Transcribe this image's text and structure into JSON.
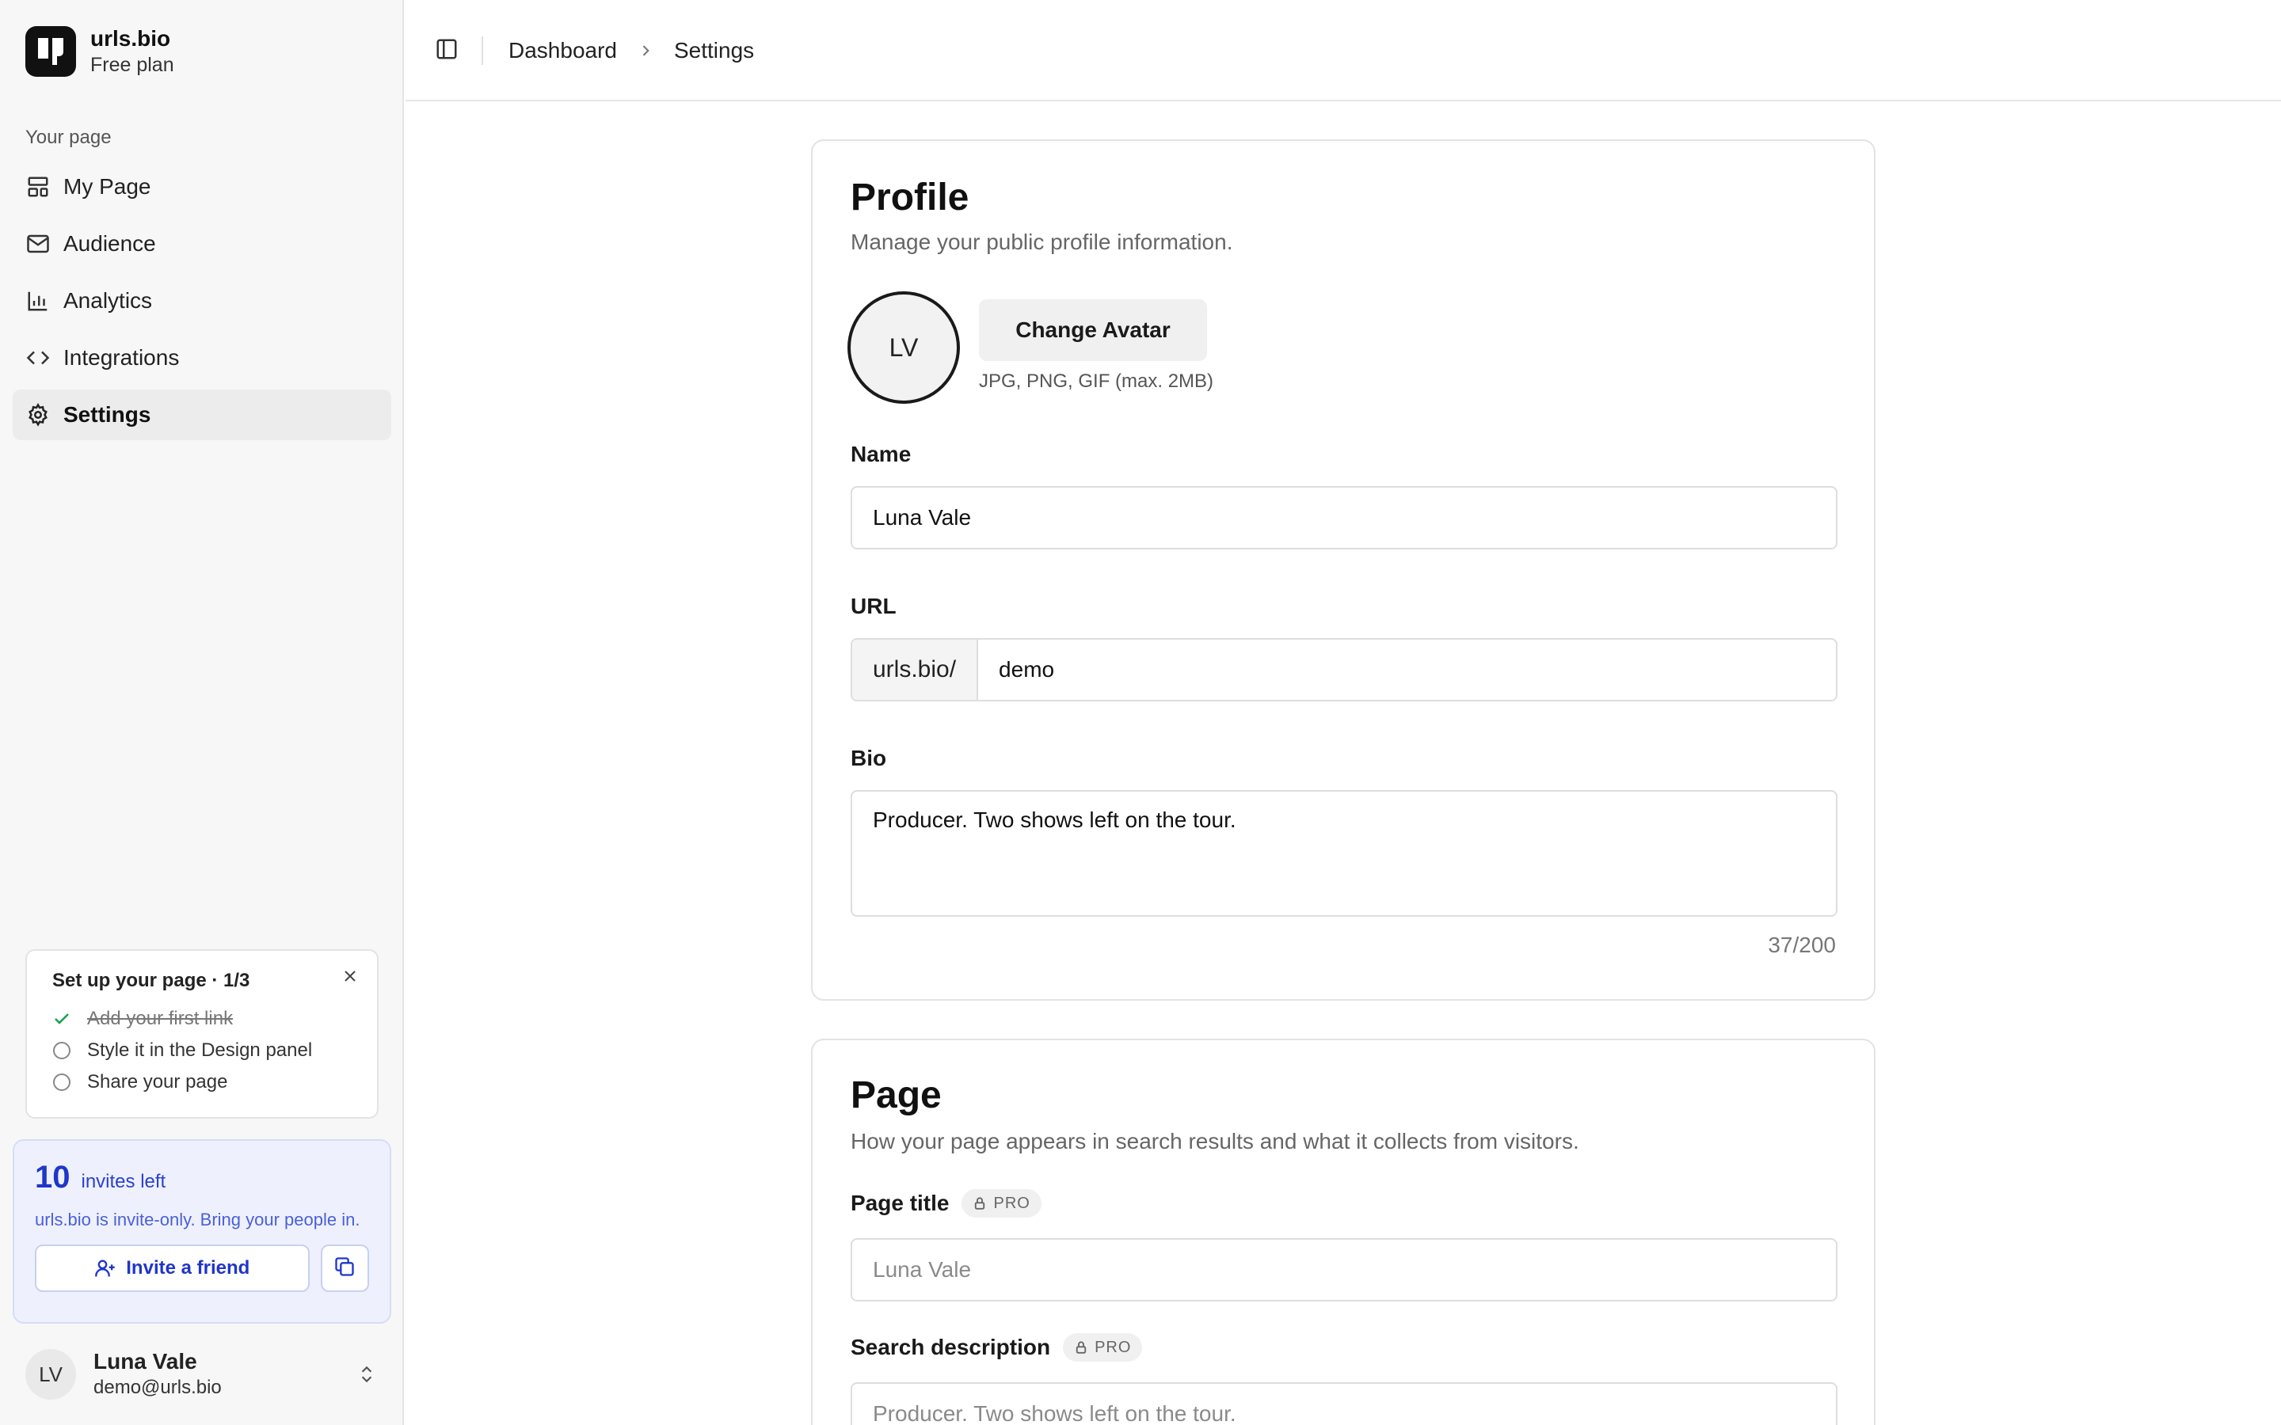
{
  "brand": {
    "name": "urls.bio",
    "plan": "Free plan"
  },
  "sidebar": {
    "section_label": "Your page",
    "items": [
      {
        "label": "My Page",
        "icon": "layout-icon"
      },
      {
        "label": "Audience",
        "icon": "mail-icon"
      },
      {
        "label": "Analytics",
        "icon": "bar-chart-icon"
      },
      {
        "label": "Integrations",
        "icon": "code-icon"
      },
      {
        "label": "Settings",
        "icon": "gear-icon",
        "active": true
      }
    ]
  },
  "setup": {
    "title": "Set up your page · 1/3",
    "steps": [
      {
        "label": "Add your first link",
        "done": true
      },
      {
        "label": "Style it in the Design panel",
        "done": false
      },
      {
        "label": "Share your page",
        "done": false
      }
    ]
  },
  "invites": {
    "count": "10",
    "left_label": "invites left",
    "description": "urls.bio is invite-only. Bring your people in.",
    "button_label": "Invite a friend"
  },
  "user": {
    "initials": "LV",
    "name": "Luna Vale",
    "email": "demo@urls.bio"
  },
  "breadcrumb": {
    "parent": "Dashboard",
    "current": "Settings"
  },
  "profile": {
    "title": "Profile",
    "subtitle": "Manage your public profile information.",
    "avatar_initials": "LV",
    "change_avatar_label": "Change Avatar",
    "avatar_hint": "JPG, PNG, GIF (max. 2MB)",
    "name_label": "Name",
    "name_value": "Luna Vale",
    "url_label": "URL",
    "url_prefix": "urls.bio/",
    "url_value": "demo",
    "bio_label": "Bio",
    "bio_value": "Producer. Two shows left on the tour.",
    "bio_counter": "37/200"
  },
  "page": {
    "title": "Page",
    "subtitle": "How your page appears in search results and what it collects from visitors.",
    "page_title_label": "Page title",
    "page_title_placeholder": "Luna Vale",
    "search_desc_label": "Search description",
    "search_desc_placeholder": "Producer. Two shows left on the tour.",
    "pro_badge": "PRO"
  },
  "colors": {
    "accent": "#2036c9",
    "invite_bg": "#eef1fd",
    "check": "#16a34a"
  }
}
